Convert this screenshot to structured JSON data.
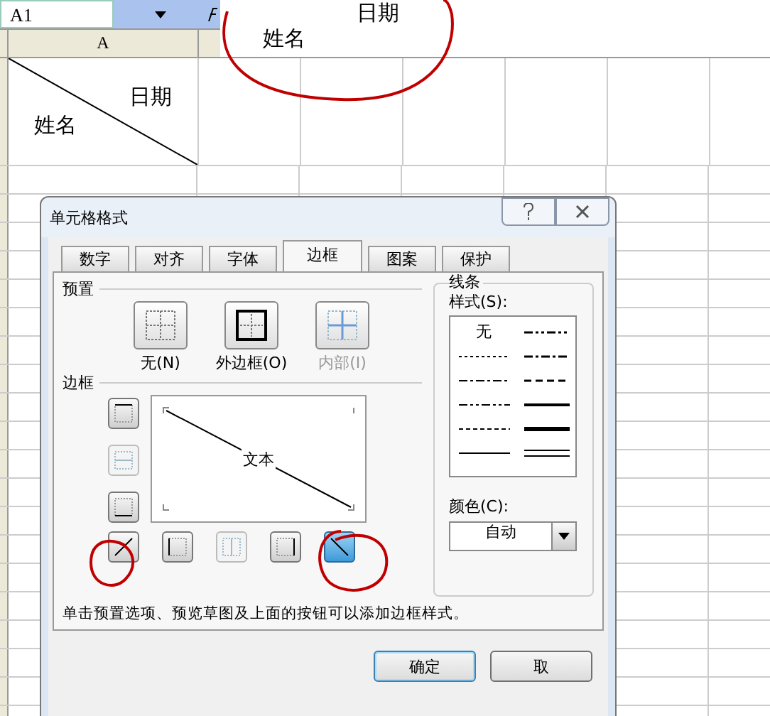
{
  "name_box": {
    "value": "A1"
  },
  "formula_bar": {
    "lines": [
      "日期",
      "姓名"
    ]
  },
  "column_headers": [
    "A"
  ],
  "cell_a1": {
    "top_right": "日期",
    "bottom_left": "姓名"
  },
  "dialog": {
    "title": "单元格格式",
    "tabs": [
      {
        "label": "数字",
        "selected": false
      },
      {
        "label": "对齐",
        "selected": false
      },
      {
        "label": "字体",
        "selected": false
      },
      {
        "label": "边框",
        "selected": true
      },
      {
        "label": "图案",
        "selected": false
      },
      {
        "label": "保护",
        "selected": false
      }
    ],
    "presets": {
      "title": "预置",
      "items": [
        {
          "label": "无(N)",
          "kind": "none",
          "disabled": false
        },
        {
          "label": "外边框(O)",
          "kind": "outline",
          "disabled": false
        },
        {
          "label": "内部(I)",
          "kind": "inside",
          "disabled": true
        }
      ]
    },
    "border": {
      "title": "边框",
      "preview_text": "文本",
      "side_buttons": [
        {
          "kind": "top",
          "disabled": false
        },
        {
          "kind": "middle",
          "disabled": true
        },
        {
          "kind": "bottom",
          "disabled": false
        }
      ],
      "bottom_buttons": [
        {
          "kind": "diag-up",
          "selected": false,
          "disabled": false
        },
        {
          "kind": "left",
          "selected": false,
          "disabled": false
        },
        {
          "kind": "center",
          "selected": false,
          "disabled": true
        },
        {
          "kind": "right",
          "selected": false,
          "disabled": false
        },
        {
          "kind": "diag-down",
          "selected": true,
          "disabled": false
        }
      ]
    },
    "line": {
      "title": "线条",
      "style_label": "样式(S):",
      "none_label": "无",
      "color_label": "颜色(C):",
      "color_value": "自动"
    },
    "hint": "单击预置选项、预览草图及上面的按钮可以添加边框样式。",
    "buttons": [
      "确定",
      "取"
    ]
  }
}
